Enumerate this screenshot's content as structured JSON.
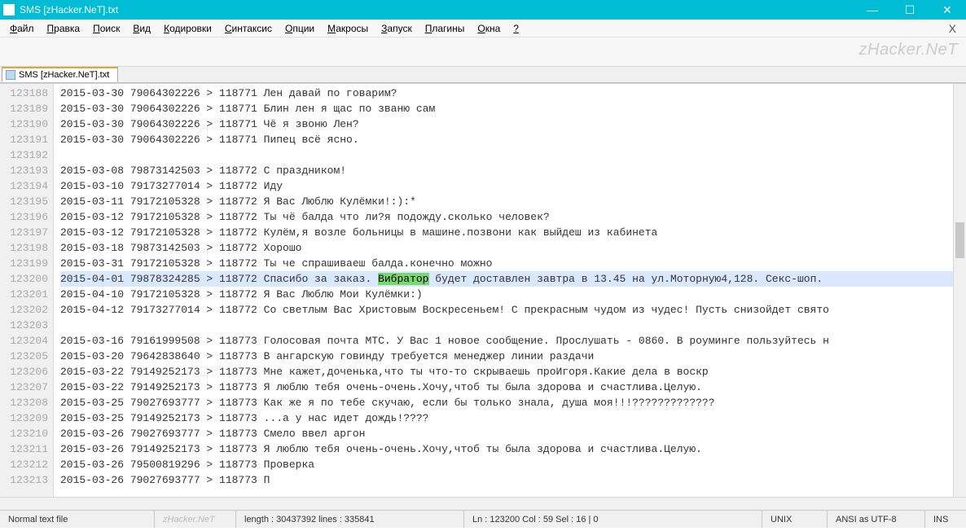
{
  "window": {
    "title": "SMS [zHacker.NeT].txt"
  },
  "menubar": {
    "items": [
      {
        "u": "Ф",
        "r": "айл"
      },
      {
        "u": "П",
        "r": "равка"
      },
      {
        "u": "П",
        "r": "оиск"
      },
      {
        "u": "В",
        "r": "ид"
      },
      {
        "u": "К",
        "r": "одировки"
      },
      {
        "u": "С",
        "r": "интаксис"
      },
      {
        "u": "О",
        "r": "пции"
      },
      {
        "u": "М",
        "r": "акросы"
      },
      {
        "u": "З",
        "r": "апуск"
      },
      {
        "u": "П",
        "r": "лагины"
      },
      {
        "u": "О",
        "r": "кна"
      },
      {
        "u": "?",
        "r": ""
      }
    ],
    "close": "X"
  },
  "watermark": "zHacker.NeT",
  "tab": {
    "label": "SMS [zHacker.NeT].txt"
  },
  "gutter": {
    "start": 123188,
    "count": 26
  },
  "lines": [
    "2015-03-30 79064302226 > 118771 Лен давай по говарим?",
    "2015-03-30 79064302226 > 118771 Блин лен я щас по званю сам",
    "2015-03-30 79064302226 > 118771 Чё я звоню Лен?",
    "2015-03-30 79064302226 > 118771 Пипец всё ясно.",
    "",
    "2015-03-08 79873142503 > 118772 С праздником!",
    "2015-03-10 79173277014 > 118772 Иду",
    "2015-03-11 79172105328 > 118772 Я Вас Люблю Кулёмки!:):*",
    "2015-03-12 79172105328 > 118772 Ты чё балда что ли?я подожду.сколько человек?",
    "2015-03-12 79172105328 > 118772 Кулём,я возле больницы в машине.позвони как выйдеш из кабинета",
    "2015-03-18 79873142503 > 118772 Хорошо",
    "2015-03-31 79172105328 > 118772 Ты че спрашиваеш балда.конечно можно",
    {
      "pre": "2015-04-01 79878324285 > 118772 Спасибо за заказ. ",
      "hl": "Вибратор",
      "post": " будет доставлен завтра в 13.45 на ул.Моторную4,128. Секс-шоп.",
      "highlight": true
    },
    "2015-04-10 79172105328 > 118772 Я Вас Люблю Мои Кулёмки:)",
    "2015-04-12 79173277014 > 118772 Со светлым Вас Христовым Воскресеньем! С прекрасным чудом из чудес! Пусть снизойдет свято",
    "",
    "2015-03-16 79161999508 > 118773 Голосовая почта МТС. У Вас 1 новое сообщение. Прослушать - 0860. В роуминге пользуйтесь н",
    "2015-03-20 79642838640 > 118773 В ангарскую говинду требуется менеджер линии раздачи",
    "2015-03-22 79149252173 > 118773 Мне кажет,доченька,что ты что-то скрываешь проИгоря.Какие дела в воскр",
    "2015-03-22 79149252173 > 118773 Я люблю тебя очень-очень.Хочу,чтоб ты была здорова и счастлива.Целую.",
    "2015-03-25 79027693777 > 118773 Как же я по тебе скучаю, если бы только знала, душа моя!!!?????????????",
    "2015-03-25 79149252173 > 118773 ...а у нас идет дождь!????",
    "2015-03-26 79027693777 > 118773 Смело ввел аргон",
    "2015-03-26 79149252173 > 118773 Я люблю тебя очень-очень.Хочу,чтоб ты была здорова и счастлива.Целую.",
    "2015-03-26 79500819296 > 118773 Проверка",
    "2015-03-26 79027693777 > 118773 П"
  ],
  "status": {
    "filetype": "Normal text file",
    "wm": "zHacker.NeT",
    "length": "length : 30437392    lines : 335841",
    "pos": "Ln : 123200    Col : 59    Sel : 16 | 0",
    "eol": "UNIX",
    "enc": "ANSI as UTF-8",
    "ins": "INS"
  }
}
